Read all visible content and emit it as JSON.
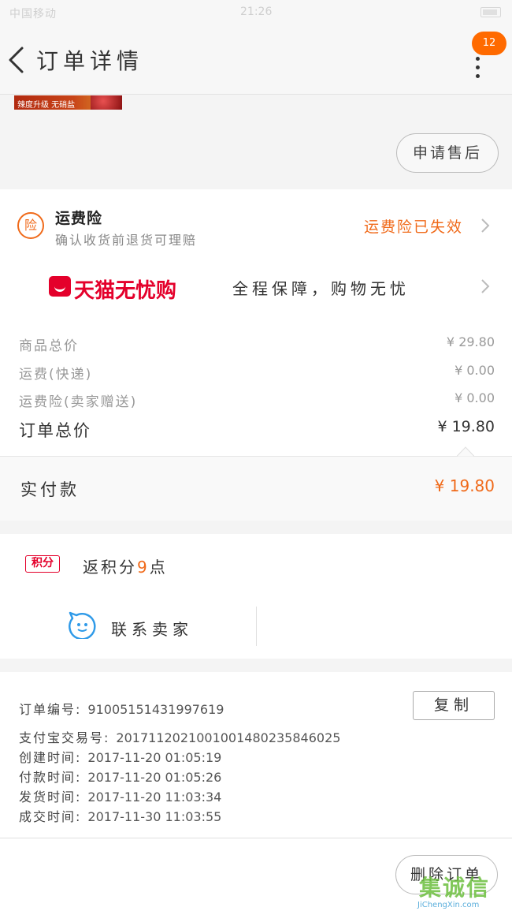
{
  "status_bar": {
    "carrier": "中国移动",
    "time": "21:26"
  },
  "header": {
    "title": "订单详情",
    "notification_count": "12"
  },
  "product": {
    "banner_text": "辣度升级 无硝盐"
  },
  "actions": {
    "after_sale": "申请售后",
    "copy": "复制",
    "delete_order": "删除订单"
  },
  "insurance": {
    "icon_text": "险",
    "title": "运费险",
    "subtitle": "确认收货前退货可理赔",
    "status": "运费险已失效"
  },
  "tmall_wuyou": {
    "logo_text": "天猫无忧购",
    "slogan": "全程保障，购物无忧"
  },
  "prices": {
    "rows": [
      {
        "label": "商品总价",
        "amount": "¥ 29.80"
      },
      {
        "label": "运费(快递)",
        "amount": "¥ 0.00"
      },
      {
        "label": "运费险(卖家赠送)",
        "amount": "¥ 0.00"
      }
    ],
    "order_total_label": "订单总价",
    "order_total_amount": "¥ 19.80",
    "paid_label": "实付款",
    "paid_amount": "¥ 19.80"
  },
  "points": {
    "badge": "积分",
    "text_prefix": "返积分",
    "count": "9",
    "text_suffix": "点"
  },
  "contact": {
    "label": "联系卖家"
  },
  "order_info": {
    "order_number_label": "订单编号:",
    "order_number": "91005151431997619",
    "alipay_label": "支付宝交易号:",
    "alipay_number": "2017112021001001480235846025",
    "created_label": "创建时间:",
    "created": "2017-11-20 01:05:19",
    "paid_label": "付款时间:",
    "paid": "2017-11-20 01:05:26",
    "shipped_label": "发货时间:",
    "shipped": "2017-11-20 11:03:34",
    "completed_label": "成交时间:",
    "completed": "2017-11-30 11:03:55"
  },
  "watermark": {
    "cn": "集诚信",
    "en": "JiChengXin.com"
  },
  "colors": {
    "accent": "#f06a1a",
    "tmall_red": "#e4002b",
    "badge": "#ff6a00"
  }
}
